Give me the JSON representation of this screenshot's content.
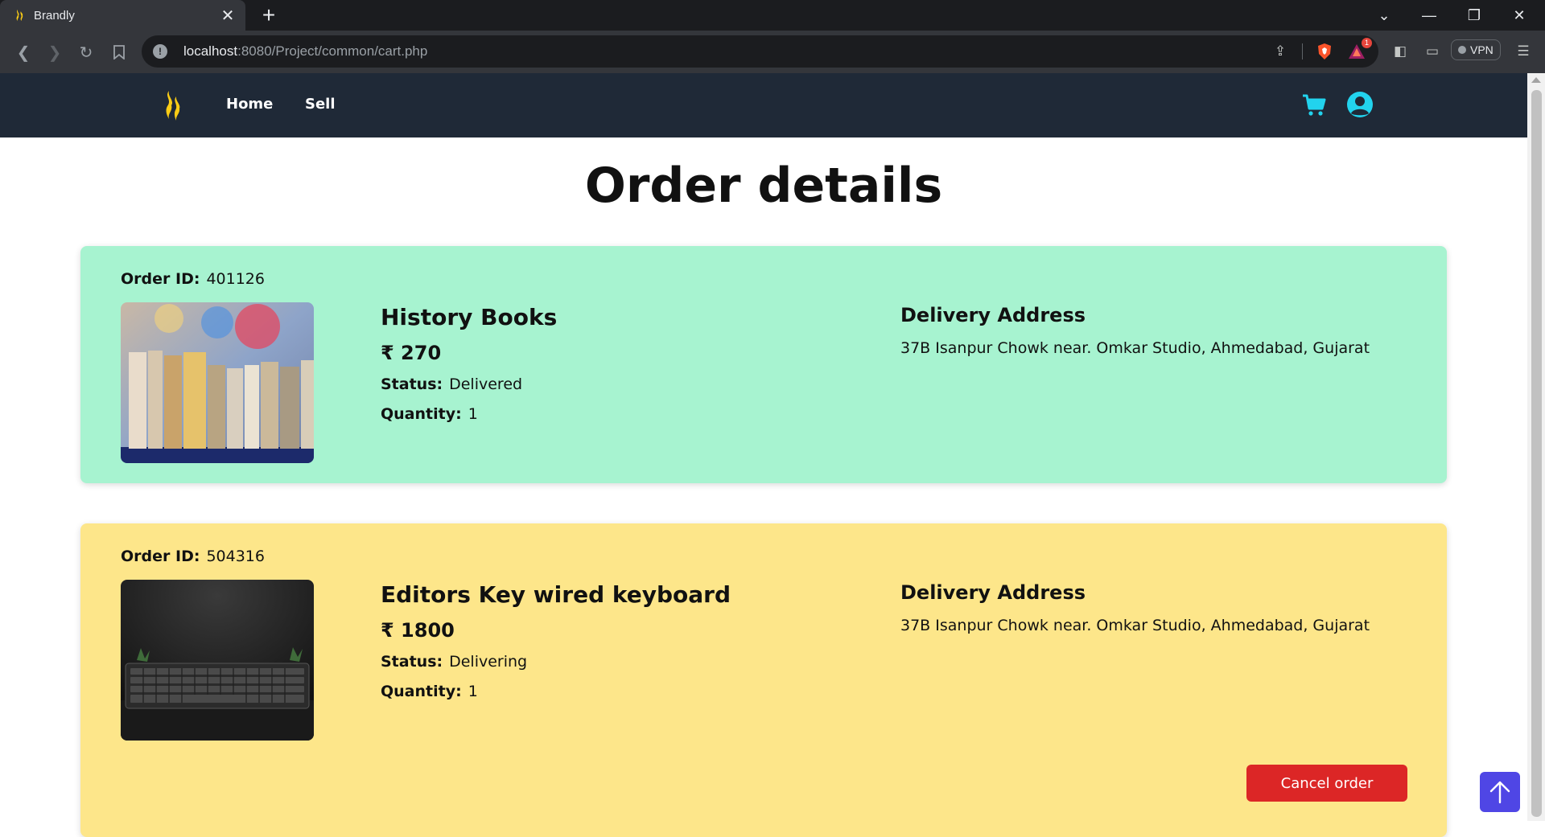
{
  "browser": {
    "tab_title": "Brandly",
    "new_tab": "+",
    "url_host": "localhost",
    "url_rest": ":8080/Project/common/cart.php",
    "vpn_label": "VPN",
    "alert_count": "1"
  },
  "site": {
    "nav_links": [
      "Home",
      "Sell"
    ],
    "accent": "#22d3ee",
    "nav_bg": "#1f2937"
  },
  "page": {
    "title": "Order details"
  },
  "orders": [
    {
      "id_label": "Order ID:",
      "id": "401126",
      "product": "History Books",
      "price": "₹ 270",
      "status_label": "Status:",
      "status": "Delivered",
      "qty_label": "Quantity:",
      "qty": "1",
      "addr_title": "Delivery Address",
      "address": "37B Isanpur Chowk near. Omkar Studio, Ahmedabad, Gujarat",
      "bg": "#a7f3d0"
    },
    {
      "id_label": "Order ID:",
      "id": "504316",
      "product": "Editors Key wired keyboard",
      "price": "₹ 1800",
      "status_label": "Status:",
      "status": "Delivering",
      "qty_label": "Quantity:",
      "qty": "1",
      "addr_title": "Delivery Address",
      "address": "37B Isanpur Chowk near. Omkar Studio, Ahmedabad, Gujarat",
      "cancel_label": "Cancel order",
      "bg": "#fde68a"
    }
  ]
}
